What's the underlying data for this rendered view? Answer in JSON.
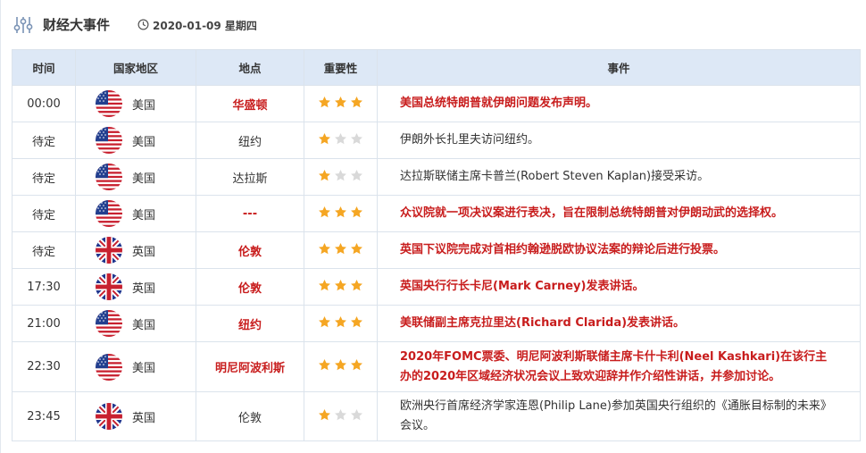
{
  "header": {
    "icon": "sliders-icon",
    "title": "财经大事件",
    "clock_icon": "clock-icon",
    "date": "2020-01-09 星期四"
  },
  "columns": [
    "时间",
    "国家地区",
    "地点",
    "重要性",
    "事件"
  ],
  "colors": {
    "highlight": "#c81d1d",
    "header_bg": "#dde8f6",
    "star_on": "#f5a623",
    "star_off": "#d9d9d9"
  },
  "rows": [
    {
      "time": "00:00",
      "country": "美国",
      "flag": "us-flag-icon",
      "location": "华盛顿",
      "importance": 3,
      "event": "美国总统特朗普就伊朗问题发布声明。",
      "highlight": true
    },
    {
      "time": "待定",
      "country": "美国",
      "flag": "us-flag-icon",
      "location": "纽约",
      "importance": 1,
      "event": "伊朗外长扎里夫访问纽约。",
      "highlight": false
    },
    {
      "time": "待定",
      "country": "美国",
      "flag": "us-flag-icon",
      "location": "达拉斯",
      "importance": 1,
      "event": "达拉斯联储主席卡普兰(Robert Steven Kaplan)接受采访。",
      "highlight": false
    },
    {
      "time": "待定",
      "country": "美国",
      "flag": "us-flag-icon",
      "location": "---",
      "importance": 3,
      "event": "众议院就一项决议案进行表决，旨在限制总统特朗普对伊朗动武的选择权。",
      "highlight": true
    },
    {
      "time": "待定",
      "country": "英国",
      "flag": "uk-flag-icon",
      "location": "伦敦",
      "importance": 3,
      "event": "英国下议院完成对首相约翰逊脱欧协议法案的辩论后进行投票。",
      "highlight": true
    },
    {
      "time": "17:30",
      "country": "英国",
      "flag": "uk-flag-icon",
      "location": "伦敦",
      "importance": 3,
      "event": "英国央行行长卡尼(Mark Carney)发表讲话。",
      "highlight": true
    },
    {
      "time": "21:00",
      "country": "美国",
      "flag": "us-flag-icon",
      "location": "纽约",
      "importance": 3,
      "event": "美联储副主席克拉里达(Richard Clarida)发表讲话。",
      "highlight": true
    },
    {
      "time": "22:30",
      "country": "美国",
      "flag": "us-flag-icon",
      "location": "明尼阿波利斯",
      "importance": 3,
      "event": "2020年FOMC票委、明尼阿波利斯联储主席卡什卡利(Neel Kashkari)在该行主办的2020年区域经济状况会议上致欢迎辞并作介绍性讲话，并参加讨论。",
      "highlight": true
    },
    {
      "time": "23:45",
      "country": "英国",
      "flag": "uk-flag-icon",
      "location": "伦敦",
      "importance": 1,
      "event": "欧洲央行首席经济学家连恩(Philip Lane)参加英国央行组织的《通胀目标制的未来》会议。",
      "highlight": false
    }
  ]
}
